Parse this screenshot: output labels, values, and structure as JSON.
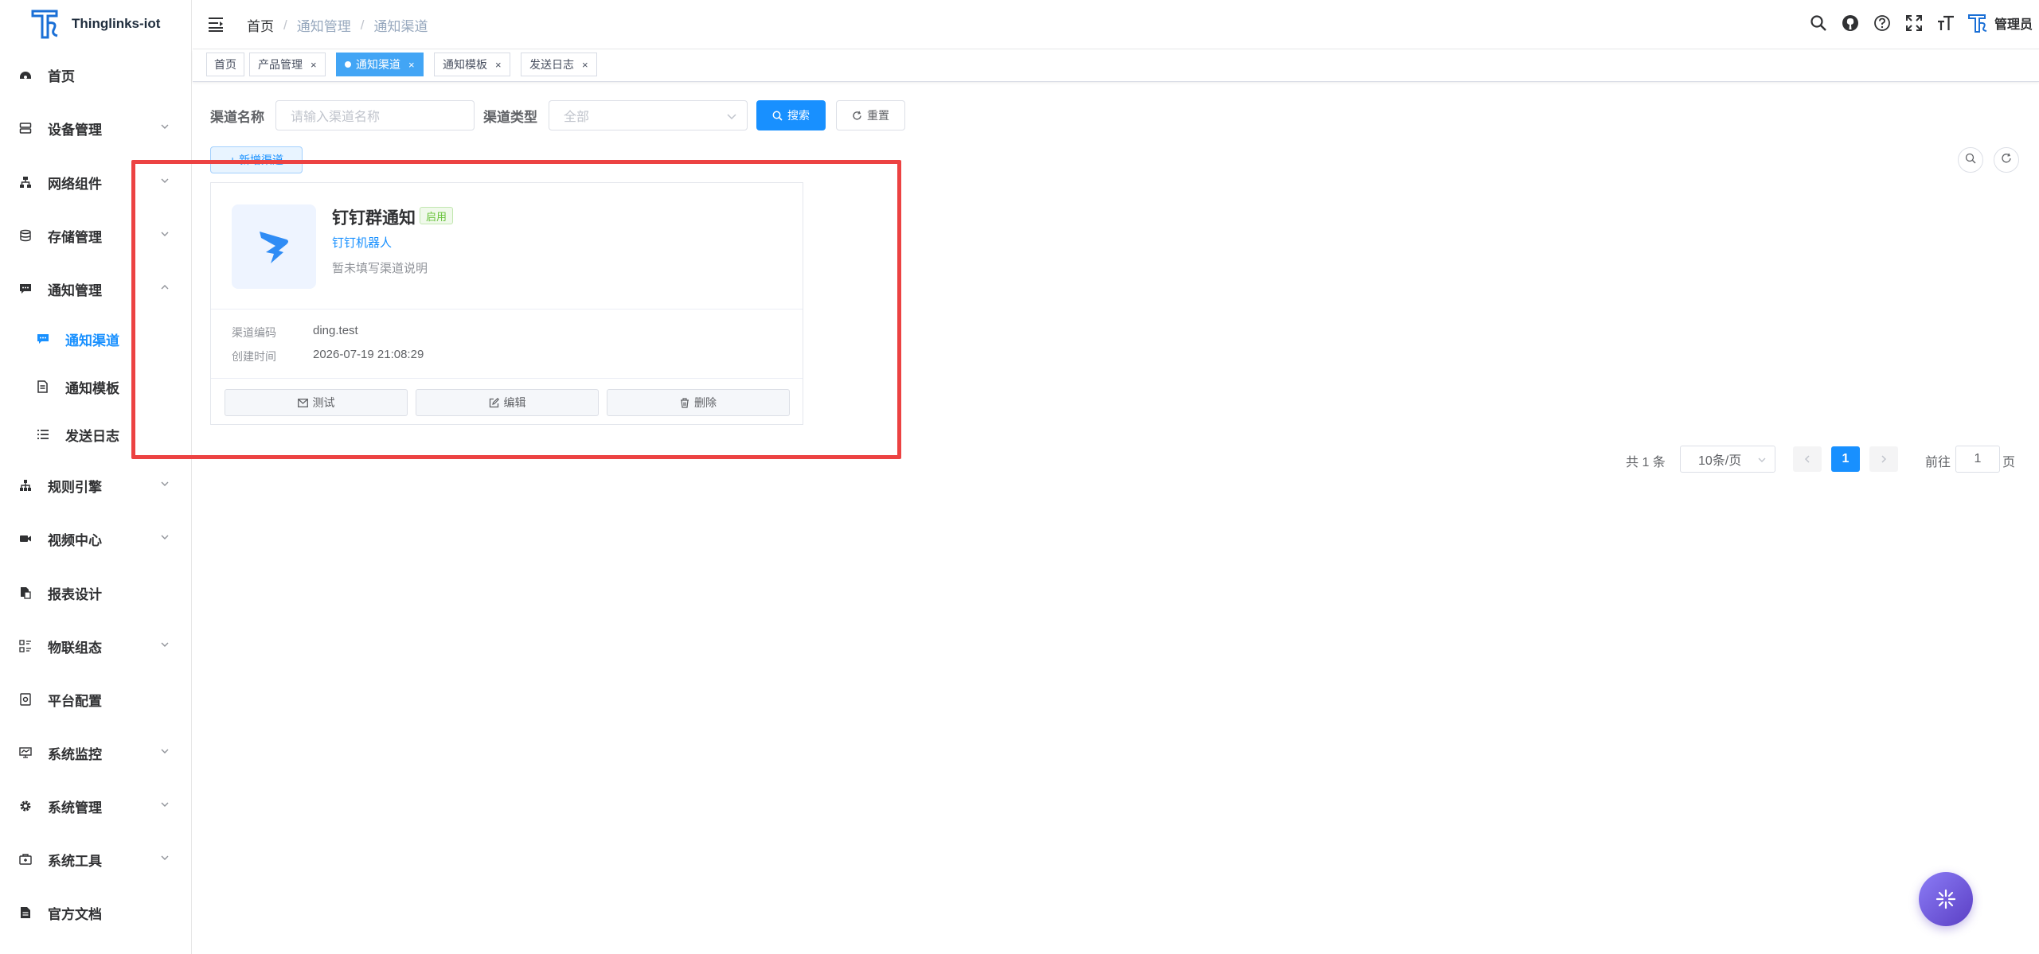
{
  "app": {
    "name": "Thinglinks-iot"
  },
  "sidebar": {
    "items": [
      {
        "label": "首页",
        "icon": "dashboard-icon"
      },
      {
        "label": "设备管理",
        "icon": "server-icon"
      },
      {
        "label": "网络组件",
        "icon": "network-icon"
      },
      {
        "label": "存储管理",
        "icon": "database-icon"
      },
      {
        "label": "通知管理",
        "icon": "message-icon"
      },
      {
        "label": "通知渠道",
        "icon": "chat-icon"
      },
      {
        "label": "通知模板",
        "icon": "document-icon"
      },
      {
        "label": "发送日志",
        "icon": "list-icon"
      },
      {
        "label": "规则引擎",
        "icon": "tree-icon"
      },
      {
        "label": "视频中心",
        "icon": "video-icon"
      },
      {
        "label": "报表设计",
        "icon": "report-icon"
      },
      {
        "label": "物联组态",
        "icon": "grid-icon"
      },
      {
        "label": "平台配置",
        "icon": "config-icon"
      },
      {
        "label": "系统监控",
        "icon": "monitor-icon"
      },
      {
        "label": "系统管理",
        "icon": "gear-icon"
      },
      {
        "label": "系统工具",
        "icon": "toolbox-icon"
      },
      {
        "label": "官方文档",
        "icon": "book-icon"
      }
    ]
  },
  "header": {
    "breadcrumb": [
      "首页",
      "通知管理",
      "通知渠道"
    ],
    "user": "管理员"
  },
  "tags": {
    "items": [
      {
        "label": "首页"
      },
      {
        "label": "产品管理",
        "close": "×"
      },
      {
        "label": "通知渠道",
        "close": "×"
      },
      {
        "label": "通知模板",
        "close": "×"
      },
      {
        "label": "发送日志",
        "close": "×"
      }
    ]
  },
  "search": {
    "name_label": "渠道名称",
    "name_placeholder": "请输入渠道名称",
    "type_label": "渠道类型",
    "type_value": "全部",
    "search_button": "搜索",
    "reset_button": "重置"
  },
  "toolbar": {
    "add_button": "+ 新增渠道"
  },
  "card": {
    "title": "钉钉群通知",
    "status": "启用",
    "type": "钉钉机器人",
    "description": "暂未填写渠道说明",
    "code_label": "渠道编码",
    "code_value": "ding.test",
    "created_label": "创建时间",
    "created_value": "2026-07-19 21:08:29",
    "test_button": "测试",
    "edit_button": "编辑",
    "delete_button": "删除"
  },
  "pagination": {
    "total_text": "共 1 条",
    "page_size": "10条/页",
    "current_page": "1",
    "goto_label": "前往",
    "goto_value": "1",
    "page_suffix": "页"
  },
  "colors": {
    "primary": "#1890ff",
    "highlight": "#ec4242",
    "success": "#67c23a",
    "active_tag": "#42a5f5"
  }
}
